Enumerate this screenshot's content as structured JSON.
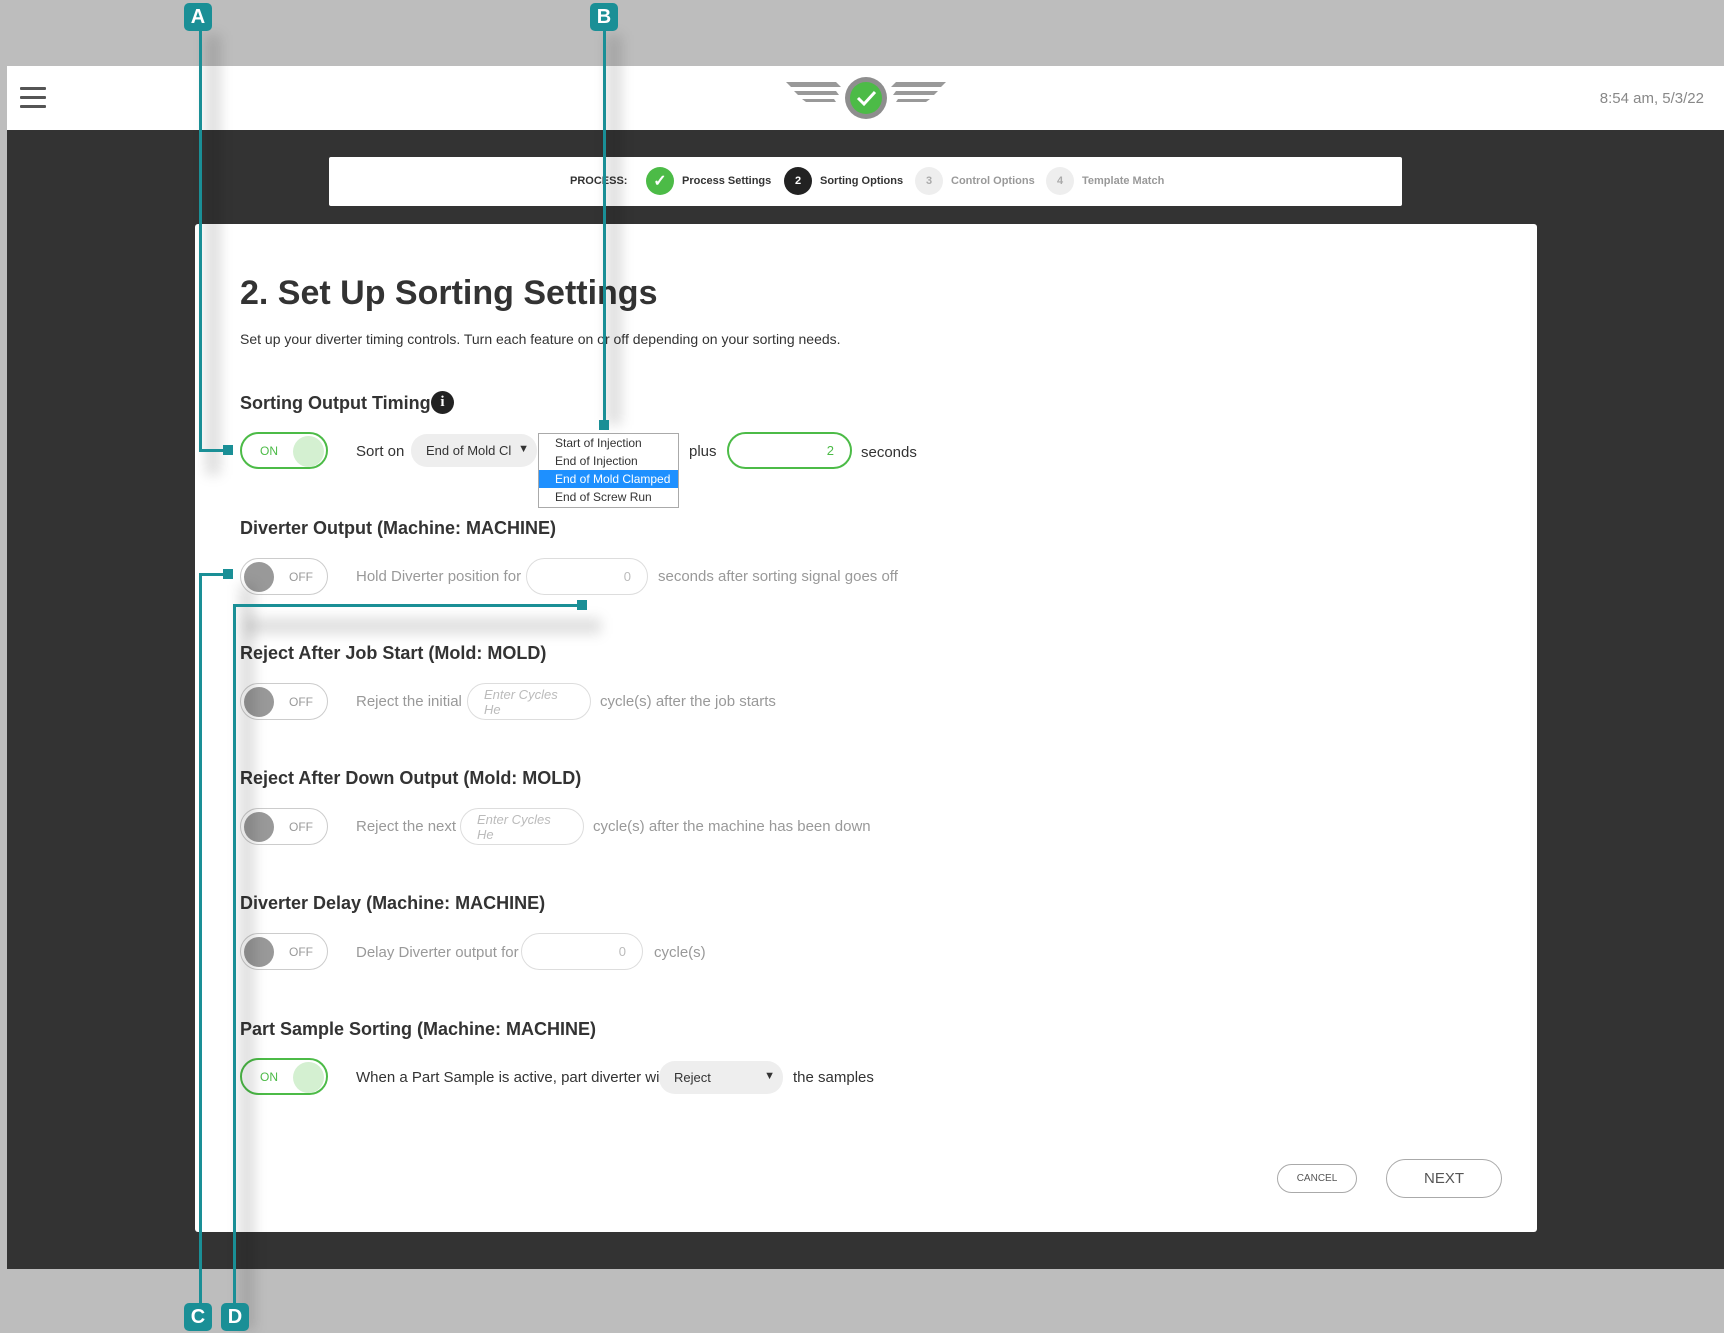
{
  "header": {
    "clock": "8:54 am, 5/3/22"
  },
  "stepper": {
    "label": "PROCESS:",
    "steps": [
      {
        "num": "",
        "label": "Process Settings",
        "state": "done"
      },
      {
        "num": "2",
        "label": "Sorting Options",
        "state": "current"
      },
      {
        "num": "3",
        "label": "Control Options",
        "state": "pending"
      },
      {
        "num": "4",
        "label": "Template Match",
        "state": "pending"
      }
    ]
  },
  "page": {
    "title": "2. Set Up Sorting Settings",
    "description": "Set up your diverter timing controls. Turn each feature on or off depending on your sorting needs."
  },
  "sorting_output": {
    "heading": "Sorting Output Timing",
    "toggle": "ON",
    "sort_on_label": "Sort on",
    "sort_on_value": "End of Mold Cl",
    "options": [
      "Start of Injection",
      "End of Injection",
      "End of Mold Clamped",
      "End of Screw Run"
    ],
    "plus_label": "plus",
    "seconds_value": "2",
    "seconds_label": "seconds"
  },
  "diverter_output": {
    "heading": "Diverter Output (Machine: MACHINE)",
    "toggle": "OFF",
    "label": "Hold Diverter position for",
    "value": "0",
    "suffix": "seconds after sorting signal goes off"
  },
  "reject_job_start": {
    "heading": "Reject After Job Start (Mold: MOLD)",
    "toggle": "OFF",
    "label": "Reject the initial",
    "placeholder": "Enter Cycles He",
    "suffix": "cycle(s) after the job starts"
  },
  "reject_down": {
    "heading": "Reject After Down Output (Mold: MOLD)",
    "toggle": "OFF",
    "label": "Reject the next",
    "placeholder": "Enter Cycles He",
    "suffix": "cycle(s) after the machine has been down"
  },
  "diverter_delay": {
    "heading": "Diverter Delay (Machine: MACHINE)",
    "toggle": "OFF",
    "label": "Delay Diverter output for",
    "value": "0",
    "suffix": "cycle(s)"
  },
  "part_sample": {
    "heading": "Part Sample Sorting (Machine: MACHINE)",
    "toggle": "ON",
    "label": "When a Part Sample is active, part diverter will",
    "select_value": "Reject",
    "suffix": "the samples"
  },
  "actions": {
    "cancel": "CANCEL",
    "next": "NEXT"
  },
  "callouts": [
    "A",
    "B",
    "C",
    "D"
  ],
  "colors": {
    "accent_green": "#4cbb47",
    "callout_teal": "#1a8f96",
    "dark_bg": "#333333",
    "outer_bg": "#bdbdbd"
  }
}
